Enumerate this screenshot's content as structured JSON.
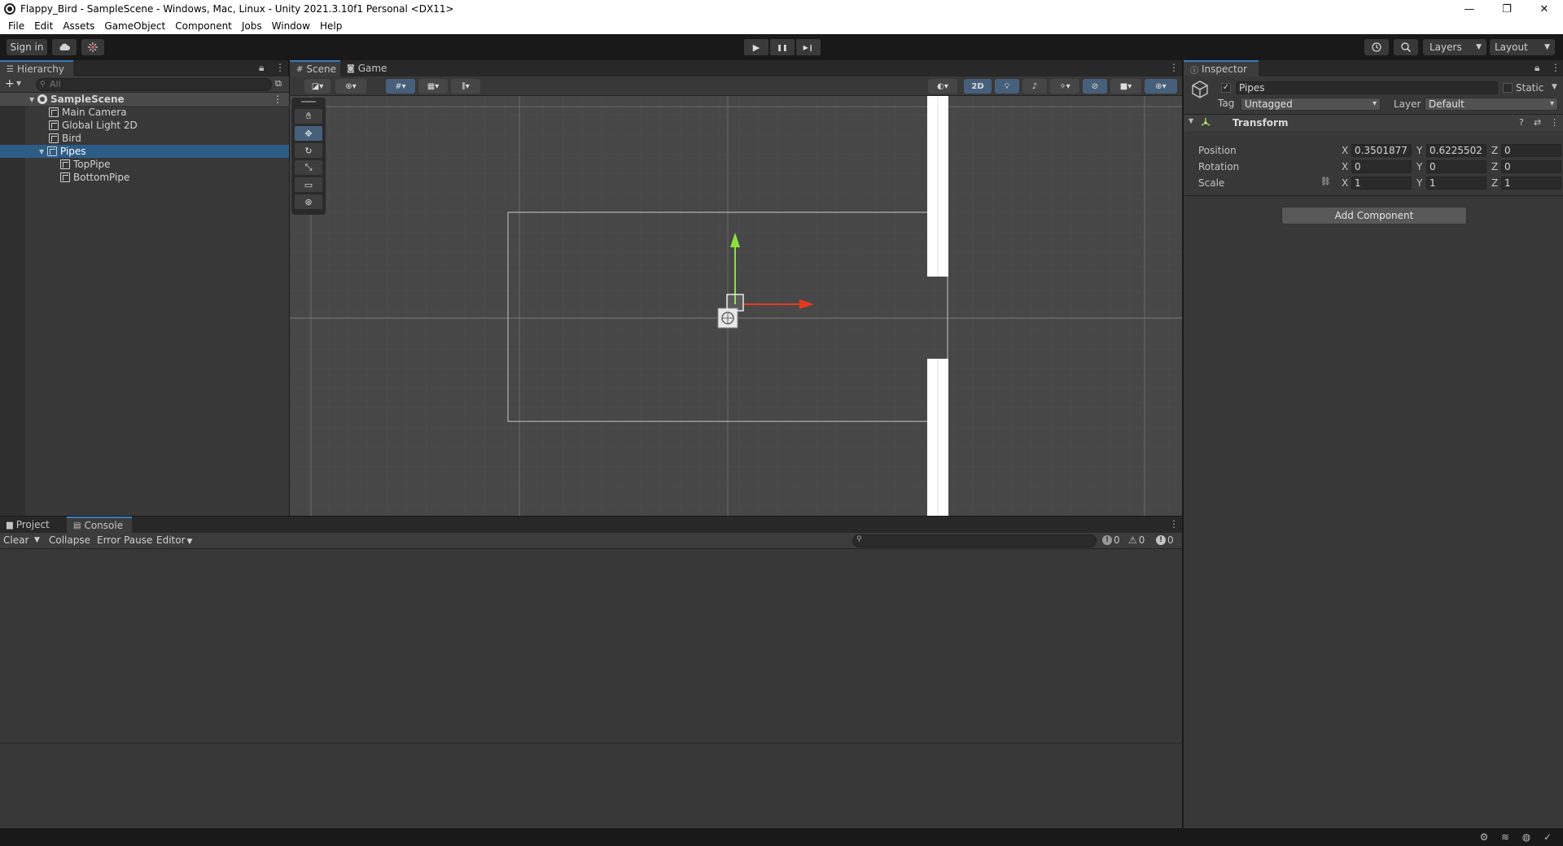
{
  "window": {
    "title": "Flappy_Bird - SampleScene - Windows, Mac, Linux - Unity 2021.3.10f1 Personal <DX11>",
    "minimize": "—",
    "restore": "❐",
    "close": "✕"
  },
  "menu": [
    "File",
    "Edit",
    "Assets",
    "GameObject",
    "Component",
    "Jobs",
    "Window",
    "Help"
  ],
  "toolbar": {
    "sign_in": "Sign in",
    "cloud_icon": "cloud-icon",
    "collab_icon": "collab-icon",
    "play_icon": "▶",
    "pause_icon": "❚❚",
    "step_icon": "▶❙",
    "history_icon": "history-icon",
    "search_icon": "search-icon",
    "layers": "Layers",
    "layout": "Layout"
  },
  "hierarchy": {
    "tab": "Hierarchy",
    "add": "+",
    "search_placeholder": "All",
    "scene": "SampleScene",
    "items": [
      {
        "label": "Main Camera"
      },
      {
        "label": "Global Light 2D"
      },
      {
        "label": "Bird"
      },
      {
        "label": "Pipes"
      },
      {
        "label": "TopPipe"
      },
      {
        "label": "BottomPipe"
      }
    ]
  },
  "scene": {
    "tab_scene": "Scene",
    "tab_game": "Game",
    "mode_2d": "2D"
  },
  "inspector": {
    "tab": "Inspector",
    "object_name": "Pipes",
    "active_checked": true,
    "static_label": "Static",
    "tag_label": "Tag",
    "tag_value": "Untagged",
    "layer_label": "Layer",
    "layer_value": "Default",
    "component_title": "Transform",
    "position_label": "Position",
    "rotation_label": "Rotation",
    "scale_label": "Scale",
    "position": {
      "x": "0.3501877",
      "y": "0.6225502",
      "z": "0"
    },
    "rotation": {
      "x": "0",
      "y": "0",
      "z": "0"
    },
    "scale": {
      "x": "1",
      "y": "1",
      "z": "1"
    },
    "axis_x": "X",
    "axis_y": "Y",
    "axis_z": "Z",
    "add_component": "Add Component"
  },
  "console": {
    "tab_project": "Project",
    "tab_console": "Console",
    "clear": "Clear",
    "collapse": "Collapse",
    "error_pause": "Error Pause",
    "editor": "Editor",
    "log_count": "0",
    "warning_count": "0",
    "error_count": "0"
  },
  "colors": {
    "accent": "#3a79bb",
    "selection": "#2c5d87",
    "gizmo_x": "#e53a22",
    "gizmo_y": "#8fe03a"
  }
}
